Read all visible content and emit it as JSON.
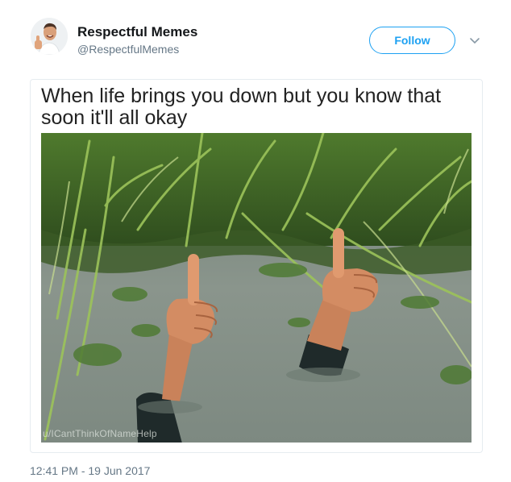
{
  "user": {
    "display_name": "Respectful Memes",
    "handle": "@RespectfulMemes"
  },
  "actions": {
    "follow_label": "Follow",
    "menu_icon": "chevron-down-icon"
  },
  "tweet": {
    "caption": "When life brings you down but you know that soon it'll all okay",
    "watermark": "u/ICantThinkOfNameHelp",
    "timestamp": "12:41 PM - 19 Jun 2017"
  },
  "colors": {
    "accent": "#1da1f2",
    "secondary_text": "#657786",
    "border": "#e6ecf0"
  }
}
